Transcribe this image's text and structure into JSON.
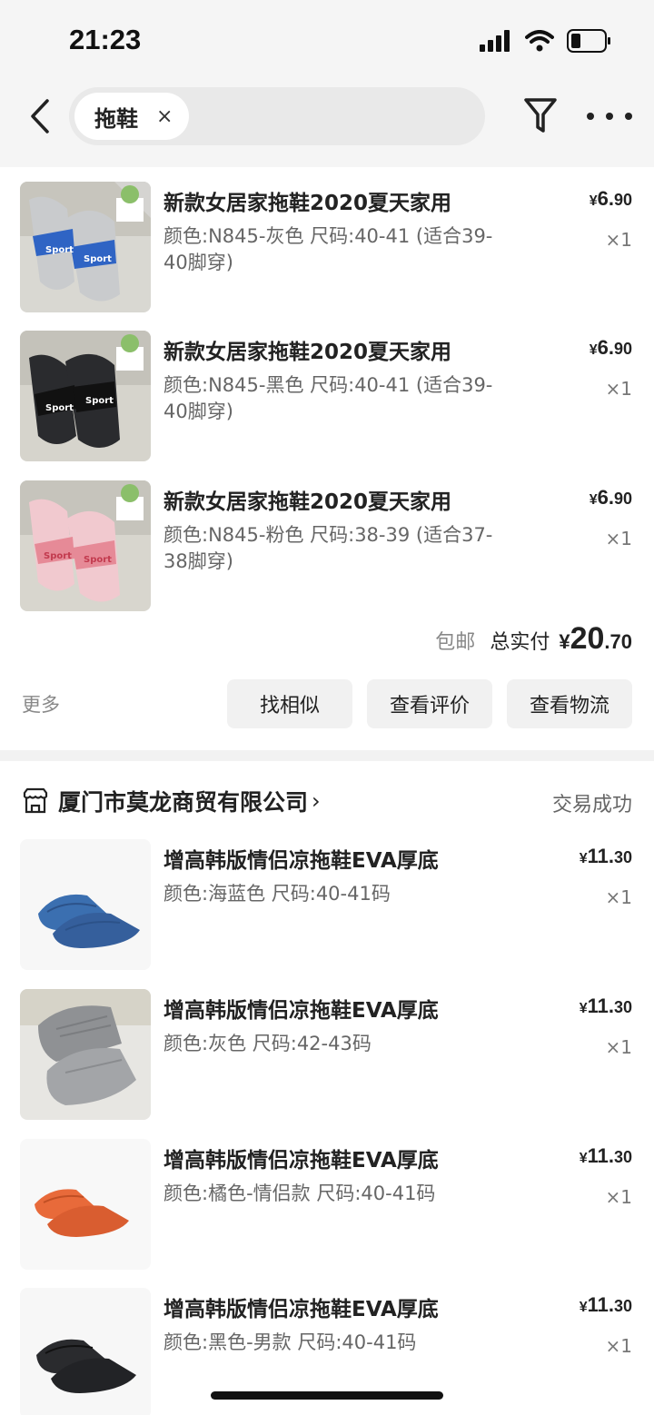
{
  "status_bar": {
    "time": "21:23"
  },
  "search": {
    "chip_label": "拖鞋",
    "chip_close": "×"
  },
  "order1": {
    "items": [
      {
        "title": "新款女居家拖鞋2020夏天家用",
        "spec": "颜色:N845-灰色 尺码:40-41 (适合39-40脚穿)",
        "price_currency": "¥",
        "price_int": "6.",
        "price_dec": "90",
        "qty": "×1"
      },
      {
        "title": "新款女居家拖鞋2020夏天家用",
        "spec": "颜色:N845-黑色 尺码:40-41 (适合39-40脚穿)",
        "price_currency": "¥",
        "price_int": "6.",
        "price_dec": "90",
        "qty": "×1"
      },
      {
        "title": "新款女居家拖鞋2020夏天家用",
        "spec": "颜色:N845-粉色 尺码:38-39 (适合37-38脚穿)",
        "price_currency": "¥",
        "price_int": "6.",
        "price_dec": "90",
        "qty": "×1"
      }
    ],
    "free_shipping": "包邮",
    "total_label": "总实付",
    "total_currency": "¥",
    "total_int": "20",
    "total_dec": ".70",
    "more": "更多",
    "buttons": [
      "找相似",
      "查看评价",
      "查看物流"
    ]
  },
  "order2": {
    "store_name": "厦门市莫龙商贸有限公司",
    "store_chevron": "›",
    "status": "交易成功",
    "items": [
      {
        "title": "增高韩版情侣凉拖鞋EVA厚底",
        "spec": "颜色:海蓝色 尺码:40-41码",
        "price_currency": "¥",
        "price_int": "11.",
        "price_dec": "30",
        "qty": "×1"
      },
      {
        "title": "增高韩版情侣凉拖鞋EVA厚底",
        "spec": "颜色:灰色 尺码:42-43码",
        "price_currency": "¥",
        "price_int": "11.",
        "price_dec": "30",
        "qty": "×1"
      },
      {
        "title": "增高韩版情侣凉拖鞋EVA厚底",
        "spec": "颜色:橘色-情侣款 尺码:40-41码",
        "price_currency": "¥",
        "price_int": "11.",
        "price_dec": "30",
        "qty": "×1"
      },
      {
        "title": "增高韩版情侣凉拖鞋EVA厚底",
        "spec": "颜色:黑色-男款 尺码:40-41码",
        "price_currency": "¥",
        "price_int": "11.",
        "price_dec": "30",
        "qty": "×1"
      }
    ]
  },
  "colors": {
    "grey_slipper": "#c9cbcd",
    "black_slipper": "#2a2b2e",
    "pink_slipper": "#f1c9cf",
    "blue_slipper": "#3b6fb0",
    "orange_slipper": "#e86a3a"
  }
}
